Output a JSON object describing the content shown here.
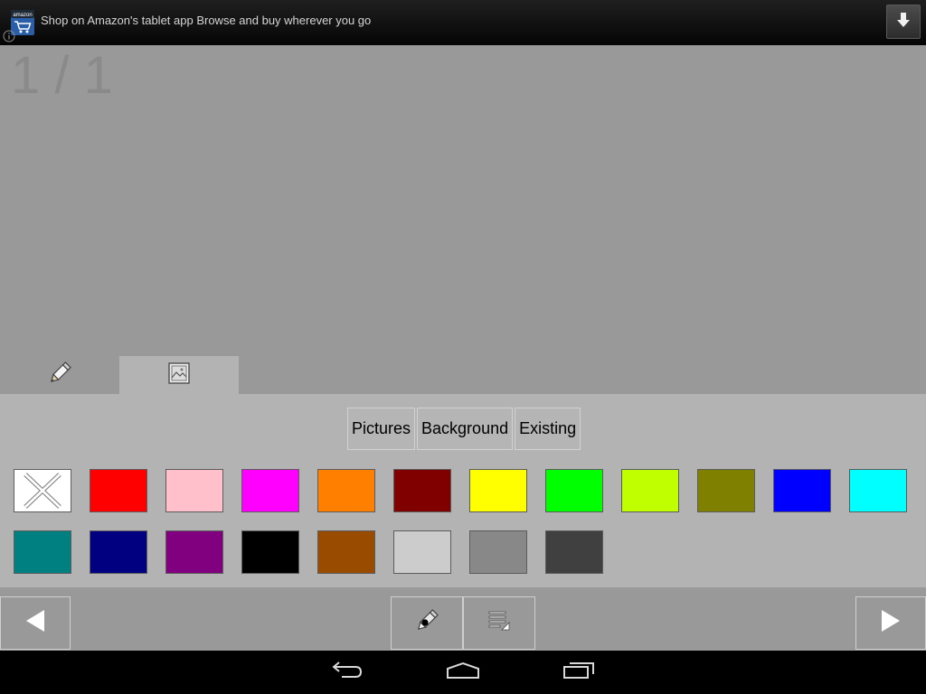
{
  "ad_banner": {
    "logo_text": "amazon",
    "text": "Shop on Amazon's tablet app Browse and buy wherever you go",
    "icons": {
      "app": "amazon-app-icon",
      "info": "info-icon",
      "download": "download-icon"
    }
  },
  "colors": {
    "canvas": "#999999",
    "panel": "#b3b3b3",
    "page_counter": "#8a8a8a"
  },
  "canvas": {
    "page_counter": "1 / 1"
  },
  "tabs": [
    {
      "icon": "pencil-icon",
      "selected": false
    },
    {
      "icon": "image-icon",
      "selected": true
    }
  ],
  "image_panel": {
    "mode_buttons": [
      "Pictures",
      "Background",
      "Existing"
    ],
    "swatch_rows": [
      [
        {
          "color": "#ffffff",
          "icon": "clear-x-icon"
        },
        {
          "color": "#ff0000"
        },
        {
          "color": "#ffc0cb"
        },
        {
          "color": "#ff00ff"
        },
        {
          "color": "#ff8000"
        },
        {
          "color": "#800000"
        },
        {
          "color": "#ffff00"
        },
        {
          "color": "#00ff00"
        },
        {
          "color": "#c0ff00"
        },
        {
          "color": "#808000"
        },
        {
          "color": "#0000ff"
        },
        {
          "color": "#00ffff"
        }
      ],
      [
        {
          "color": "#008080"
        },
        {
          "color": "#000080"
        },
        {
          "color": "#800080"
        },
        {
          "color": "#000000"
        },
        {
          "color": "#994c00"
        },
        {
          "color": "#cccccc"
        },
        {
          "color": "#888888"
        },
        {
          "color": "#404040"
        }
      ]
    ]
  },
  "toolbar": {
    "icons": {
      "previous": "previous-page-icon",
      "pen": "pen-settings-icon",
      "edit": "edit-list-icon",
      "next": "next-page-icon"
    }
  },
  "nav_bar": {
    "icons": {
      "back": "back-icon",
      "home": "home-icon",
      "recent": "recent-apps-icon"
    }
  }
}
